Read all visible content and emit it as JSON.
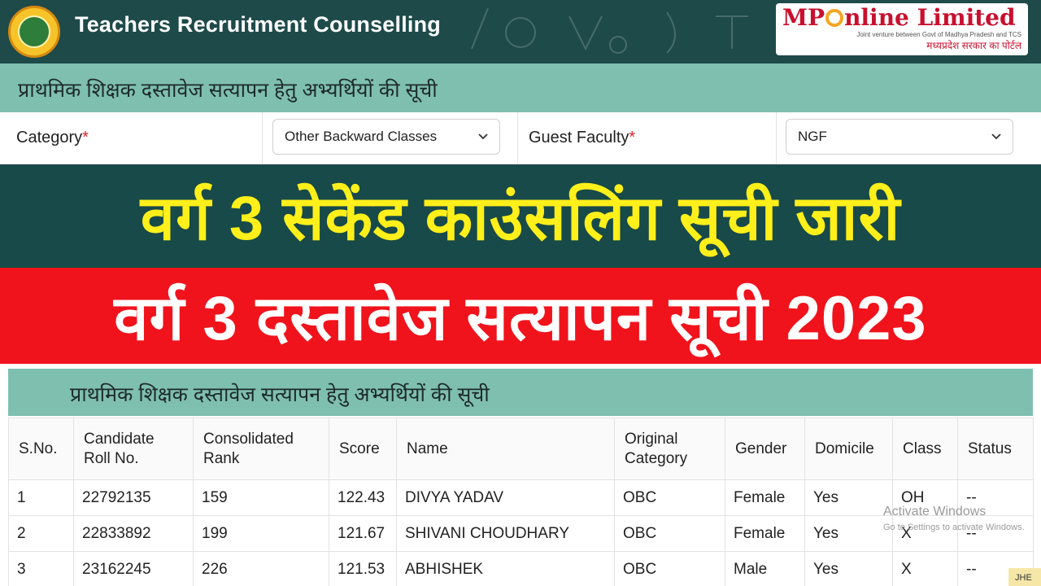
{
  "header": {
    "title": "Teachers Recruitment Counselling",
    "brand_name_pre": "MP",
    "brand_name_post": "nline Limited",
    "brand_tagline": "Joint venture between Govt of Madhya Pradesh and TCS",
    "brand_hindi": "मध्यप्रदेश सरकार का पोर्टल"
  },
  "section": {
    "title": "प्राथमिक शिक्षक दस्तावेज सत्यापन हेतु अभ्यर्थियों की सूची"
  },
  "filters": {
    "category_label": "Category",
    "category_value": "Other Backward Classes",
    "guest_label": "Guest Faculty",
    "guest_value": "NGF",
    "required_mark": "*"
  },
  "banners": {
    "line1": "वर्ग 3 सेकेंड काउंसलिंग सूची जारी",
    "line2": "वर्ग 3 दस्तावेज सत्यापन सूची 2023"
  },
  "panel": {
    "title": "प्राथमिक शिक्षक दस्तावेज सत्यापन हेतु अभ्यर्थियों की सूची"
  },
  "table": {
    "headers": [
      "S.No.",
      "Candidate Roll No.",
      "Consolidated Rank",
      "Score",
      "Name",
      "Original Category",
      "Gender",
      "Domicile",
      "Class",
      "Status"
    ],
    "rows": [
      [
        "1",
        "22792135",
        "159",
        "122.43",
        "DIVYA YADAV",
        "OBC",
        "Female",
        "Yes",
        "OH",
        "--"
      ],
      [
        "2",
        "22833892",
        "199",
        "121.67",
        "SHIVANI CHOUDHARY",
        "OBC",
        "Female",
        "Yes",
        "X",
        "--"
      ],
      [
        "3",
        "23162245",
        "226",
        "121.53",
        "ABHISHEK",
        "OBC",
        "Male",
        "Yes",
        "X",
        "--"
      ]
    ]
  },
  "watermark": {
    "line1": "Activate Windows",
    "line2": "Go to Settings to activate Windows."
  },
  "corner_tag": "JHE",
  "colors": {
    "header_bg": "#1e4a4a",
    "section_bg": "#7fbfb0",
    "banner1_bg": "#174a48",
    "banner1_text": "#ffef1a",
    "banner2_bg": "#f0131c",
    "banner2_text": "#ffffff",
    "brand_red": "#c8102e"
  },
  "icons": {
    "emblem": "state-emblem-icon",
    "select_chevron": "chevron-down-icon"
  }
}
